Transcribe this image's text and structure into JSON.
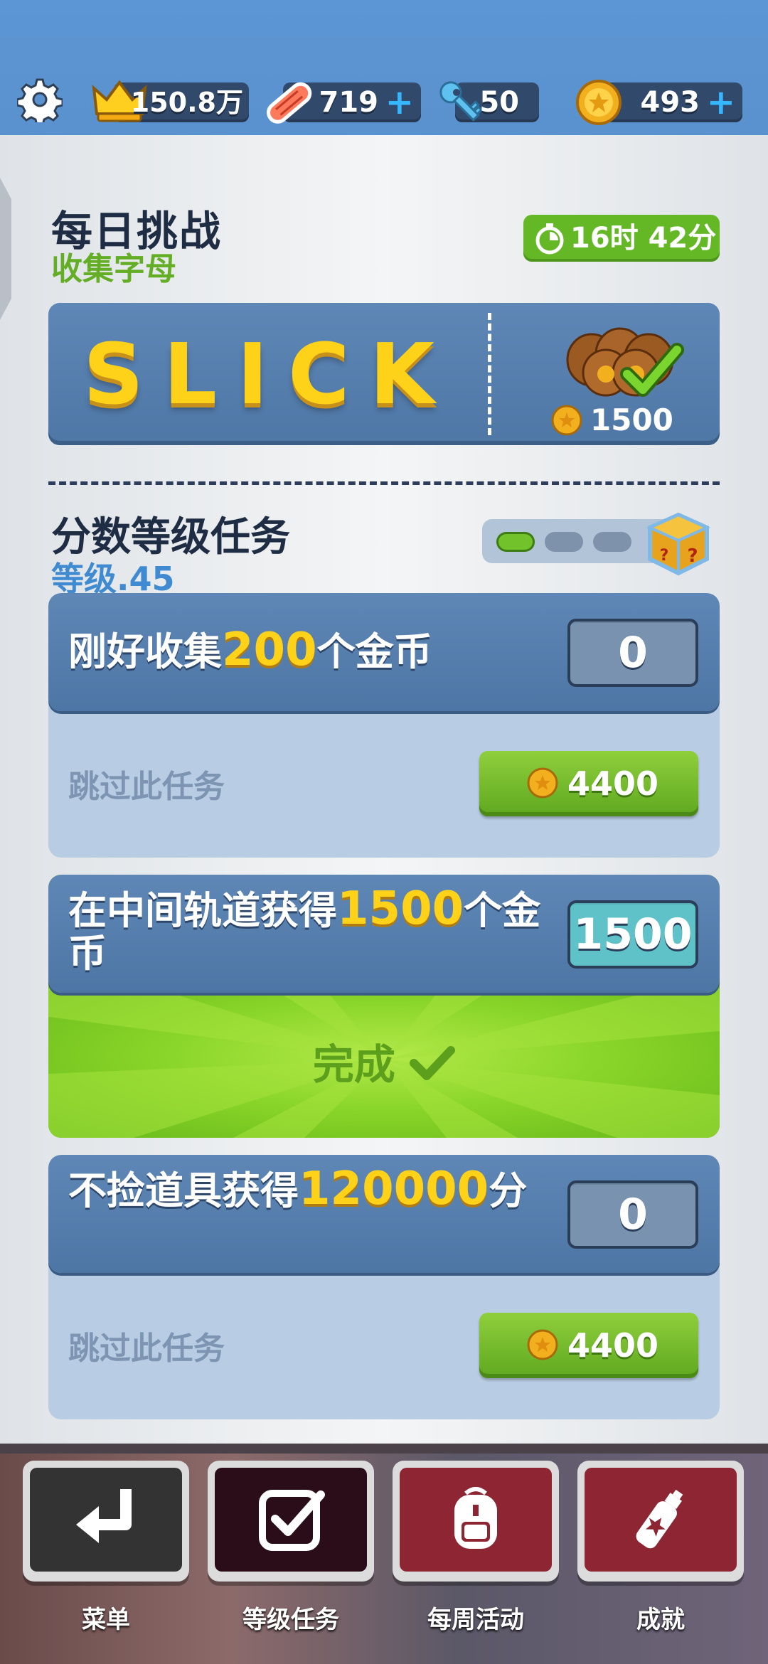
{
  "top_bar": {
    "score": "150.8万",
    "hoverboards": "719",
    "keys": "50",
    "coins": "493",
    "plus": "+"
  },
  "daily_challenge": {
    "title": "每日挑战",
    "subtitle": "收集字母",
    "timer": "16时 42分",
    "word": "SLICK",
    "reward": "1500"
  },
  "score_missions": {
    "title": "分数等级任务",
    "level": "等级.45",
    "progress_filled": 1,
    "progress_total": 3
  },
  "tasks": [
    {
      "pre": "刚好收集",
      "highlight": "200",
      "post": "个金币",
      "value": "0",
      "skip_label": "跳过此任务",
      "skip_cost": "4400"
    },
    {
      "pre": "在中间轨道获得",
      "highlight": "1500",
      "post": "个金币",
      "value": "1500",
      "done_label": "完成"
    },
    {
      "pre": "不捡道具获得",
      "highlight": "120000",
      "post": "分",
      "value": "0",
      "skip_label": "跳过此任务",
      "skip_cost": "4400"
    }
  ],
  "bottom_nav": [
    {
      "label": "菜单",
      "icon": "return-arrow-icon",
      "color": "#333333"
    },
    {
      "label": "等级任务",
      "icon": "checkbox-icon",
      "color": "#2a0d18"
    },
    {
      "label": "每周活动",
      "icon": "backpack-icon",
      "color": "#8e2532"
    },
    {
      "label": "成就",
      "icon": "spray-can-icon",
      "color": "#8e2532"
    }
  ],
  "colors": {
    "accent_green": "#64b826",
    "gold": "#ffd21a",
    "panel_blue": "#5f87b6"
  }
}
